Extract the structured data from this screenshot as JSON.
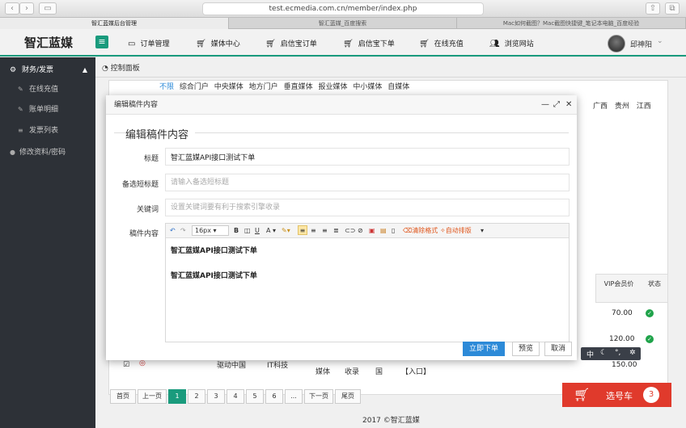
{
  "browser": {
    "url": "test.ecmedia.com.cn/member/index.php",
    "tabs": [
      "智汇蓝媒后台管理",
      "智汇蓝媒_百度搜索",
      "Mac如何截图？Mac截图快捷键_笔记本电脑_百度经验"
    ]
  },
  "header": {
    "logo": "智汇蓝媒",
    "menu": [
      {
        "icon": "monitor-icon",
        "label": "订单管理"
      },
      {
        "icon": "cart-icon",
        "label": "媒体中心"
      },
      {
        "icon": "cart-icon",
        "label": "启信宝订单"
      },
      {
        "icon": "cart-icon",
        "label": "启信宝下单"
      },
      {
        "icon": "cart-icon",
        "label": "在线充值"
      },
      {
        "icon": "users-icon",
        "label": "浏览网站"
      }
    ],
    "username": "邱神阳"
  },
  "sidebar": {
    "section": "财务/发票",
    "items": [
      "在线充值",
      "账单明细",
      "发票列表"
    ],
    "extra": "修改资料/密码"
  },
  "main": {
    "breadcrumb": "控制面板",
    "filter_prefix": "不限",
    "filters": [
      "综合门户",
      "中央媒体",
      "地方门户",
      "垂直媒体",
      "报业媒体",
      "中小媒体",
      "自媒体"
    ],
    "regions": [
      "广西",
      "贵州",
      "江西"
    ],
    "table_headers": [
      "VIP会员价",
      "状态"
    ],
    "prices": [
      "70.00",
      "120.00",
      "150.00"
    ],
    "bottom_row": {
      "name": "驱动中国",
      "category": "IT科技",
      "c1": "媒体",
      "c2": "收录",
      "c3": "国",
      "c4": "【入口】"
    }
  },
  "pager": {
    "labels": [
      "首页",
      "上一页",
      "1",
      "2",
      "3",
      "4",
      "5",
      "6",
      "...",
      "下一页",
      "尾页"
    ],
    "current": "1"
  },
  "footer": "2017 ©智汇蓝媒",
  "cart": {
    "label": "选号车",
    "count": "3"
  },
  "ime": {
    "lang": "中"
  },
  "dialog": {
    "title": "编辑稿件内容",
    "section_title": "编辑稿件内容",
    "fields": {
      "title_label": "标题",
      "title_value": "智汇蓝媒API接口测试下单",
      "subtitle_label": "备选短标题",
      "subtitle_placeholder": "请输入备选短标题",
      "keywords_label": "关键词",
      "keywords_placeholder": "设置关键词要有利于搜索引擎收录",
      "content_label": "稿件内容"
    },
    "editor": {
      "font_size": "16px",
      "clear_format": "清除格式",
      "auto_layout": "自动排版",
      "paragraphs": [
        "智汇蓝媒API接口测试下单",
        "智汇蓝媒API接口测试下单"
      ]
    },
    "buttons": {
      "submit": "立即下单",
      "preview": "预览",
      "cancel": "取消"
    }
  }
}
